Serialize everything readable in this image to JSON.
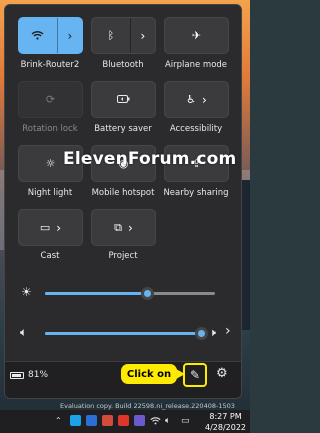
{
  "watermark": "ElevenForum.com",
  "tiles": [
    {
      "label": "Brink-Router2",
      "state": "on"
    },
    {
      "label": "Bluetooth",
      "state": "off"
    },
    {
      "label": "Airplane mode",
      "state": "off"
    },
    {
      "label": "Rotation lock",
      "state": "disabled"
    },
    {
      "label": "Battery saver",
      "state": "off"
    },
    {
      "label": "Accessibility",
      "state": "off"
    },
    {
      "label": "Night light",
      "state": "off"
    },
    {
      "label": "Mobile hotspot",
      "state": "off"
    },
    {
      "label": "Nearby sharing",
      "state": "off"
    },
    {
      "label": "Cast",
      "state": "off"
    },
    {
      "label": "Project",
      "state": "off"
    }
  ],
  "sliders": {
    "brightness": {
      "value": 60
    },
    "volume": {
      "value": 100
    }
  },
  "footer": {
    "battery_percent": "81%",
    "callout": "Click on"
  },
  "eval_text": "Evaluation copy. Build 22598.ni_release.220408-1503",
  "taskbar": {
    "time": "8:27 PM",
    "date": "4/28/2022"
  },
  "colors": {
    "accent": "#66b5f2",
    "callout": "#ffeb00",
    "panel": "#2b2b2e"
  }
}
